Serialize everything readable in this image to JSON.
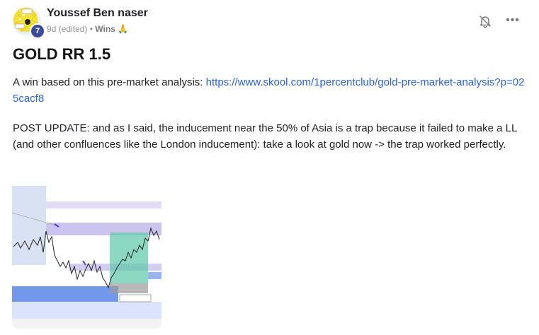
{
  "post": {
    "author": "Youssef Ben naser",
    "level": "7",
    "time": "9d (edited)",
    "separator": "•",
    "category": "Wins",
    "category_emoji": "🙏",
    "title": "GOLD RR 1.5",
    "para1_text": "A win based on this pre-market analysis: ",
    "para1_link": "https://www.skool.com/1percentclub/gold-pre-market-analysis?p=025cacf8",
    "para2": "POST UPDATE: and as I said, the inducement near the 50% of Asia is a trap because it failed to make a LL (and other confluences like the London inducement): take a look at gold now -> the trap worked perfectly."
  },
  "icons": {
    "bell": "bell-off-icon",
    "more": "more-icon",
    "more_glyph": "•••"
  },
  "colors": {
    "link": "#2b62d6",
    "level_badge": "#3c4c9a",
    "zone_purple": "#b9b0e8",
    "zone_blue": "#4f7ee6",
    "zone_green": "#5cc7a8"
  }
}
